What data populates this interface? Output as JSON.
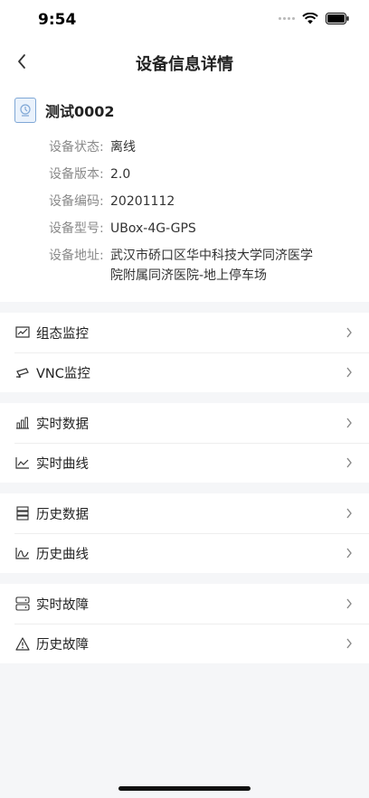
{
  "status_bar": {
    "time": "9:54"
  },
  "nav": {
    "title": "设备信息详情"
  },
  "device": {
    "name": "测试0002",
    "fields": [
      {
        "label": "设备状态:",
        "value": "离线"
      },
      {
        "label": "设备版本:",
        "value": "2.0"
      },
      {
        "label": "设备编码:",
        "value": "20201112"
      },
      {
        "label": "设备型号:",
        "value": "UBox-4G-GPS"
      },
      {
        "label": "设备地址:",
        "value": "武汉市硚口区华中科技大学同济医学院附属同济医院-地上停车场"
      }
    ]
  },
  "menu_groups": [
    {
      "items": [
        {
          "label": "组态监控",
          "icon": "monitor-chart-icon"
        },
        {
          "label": "VNC监控",
          "icon": "camera-icon"
        }
      ]
    },
    {
      "items": [
        {
          "label": "实时数据",
          "icon": "bar-chart-icon"
        },
        {
          "label": "实时曲线",
          "icon": "line-chart-icon"
        }
      ]
    },
    {
      "items": [
        {
          "label": "历史数据",
          "icon": "database-icon"
        },
        {
          "label": "历史曲线",
          "icon": "curve-chart-icon"
        }
      ]
    },
    {
      "items": [
        {
          "label": "实时故障",
          "icon": "server-icon"
        },
        {
          "label": "历史故障",
          "icon": "warning-icon"
        }
      ]
    }
  ]
}
